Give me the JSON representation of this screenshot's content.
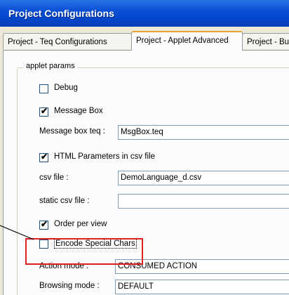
{
  "window": {
    "title": "Project Configurations"
  },
  "tabs": [
    {
      "label": "Project - Teq Configurations",
      "active": false
    },
    {
      "label": "Project - Applet Advanced",
      "active": true
    },
    {
      "label": "Project - Bu",
      "active": false
    }
  ],
  "group": {
    "label": "applet params"
  },
  "fields": {
    "debug": {
      "label": "Debug",
      "checked": false
    },
    "message_box": {
      "label": "Message Box",
      "checked": true
    },
    "message_box_teq": {
      "label": "Message box teq :",
      "value": "MsgBox.teq"
    },
    "html_params": {
      "label": "HTML Parameters in csv file",
      "checked": true
    },
    "csv_file": {
      "label": "csv file :",
      "value": "DemoLanguage_d.csv"
    },
    "static_csv_file": {
      "label": "static csv file :",
      "value": ""
    },
    "order_per_view": {
      "label": "Order per view",
      "checked": true
    },
    "encode_special_chars": {
      "label": "Encode Special Chars",
      "checked": false
    },
    "action_mode": {
      "label": "Action mode :",
      "value": "CONSUMED ACTION"
    },
    "browsing_mode": {
      "label": "Browsing mode :",
      "value": "DEFAULT"
    }
  },
  "annotation": {
    "color": "#e02020"
  },
  "checkmark": "✔"
}
